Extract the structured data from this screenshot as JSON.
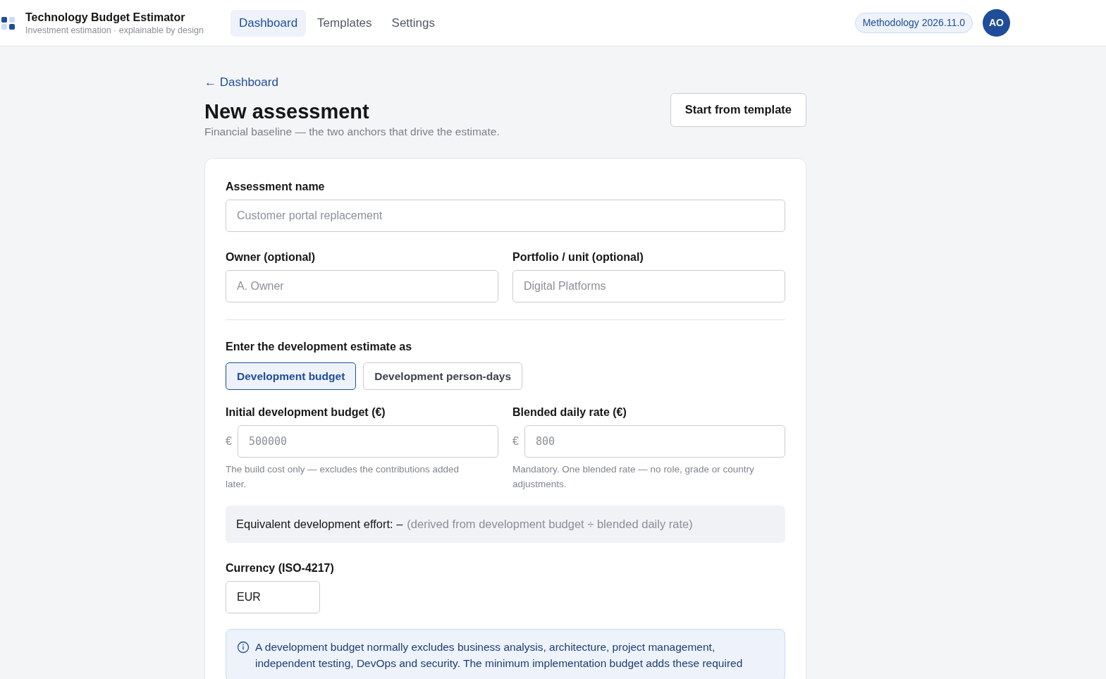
{
  "app": {
    "title": "Technology Budget Estimator",
    "subtitle": "Investment estimation · explainable by design"
  },
  "nav": [
    {
      "label": "Dashboard",
      "selected": true
    },
    {
      "label": "Templates",
      "selected": false
    },
    {
      "label": "Settings",
      "selected": false
    }
  ],
  "methodology_badge": "Methodology 2026.11.0",
  "avatar": "AO",
  "back_link": "← Dashboard",
  "page_title": "New assessment",
  "page_subtitle": "Financial baseline — the two anchors that drive the estimate.",
  "template_button": "Start from template",
  "form": {
    "name_field": {
      "label": "Assessment name",
      "placeholder": "Customer portal replacement"
    },
    "owner_field": {
      "label": "Owner (optional)",
      "placeholder": "A. Owner"
    },
    "portfolio_field": {
      "label": "Portfolio / unit (optional)",
      "placeholder": "Digital Platforms"
    },
    "mode_label": "Enter the development estimate as",
    "modes": [
      {
        "label": "Development budget",
        "selected": true
      },
      {
        "label": "Development person-days",
        "selected": false
      }
    ],
    "money_fields": [
      {
        "label": "Initial development budget (€)",
        "prefix": "€",
        "placeholder": "500000",
        "help": "The build cost only — excludes the contributions added later."
      },
      {
        "label": "Blended daily rate (€)",
        "prefix": "€",
        "placeholder": "800",
        "help": "Mandatory. One blended rate — no role, grade or country adjustments."
      }
    ],
    "effort": {
      "label": "Equivalent development effort: –",
      "note": "(derived from development budget ÷ blended daily rate)"
    },
    "currency_field": {
      "label": "Currency (ISO-4217)",
      "value": "EUR"
    },
    "info_note": {
      "lines": [
        "A development budget normally excludes business analysis, architecture, project management,",
        "independent testing, DevOps and security. The minimum implementation budget adds these required"
      ]
    }
  }
}
